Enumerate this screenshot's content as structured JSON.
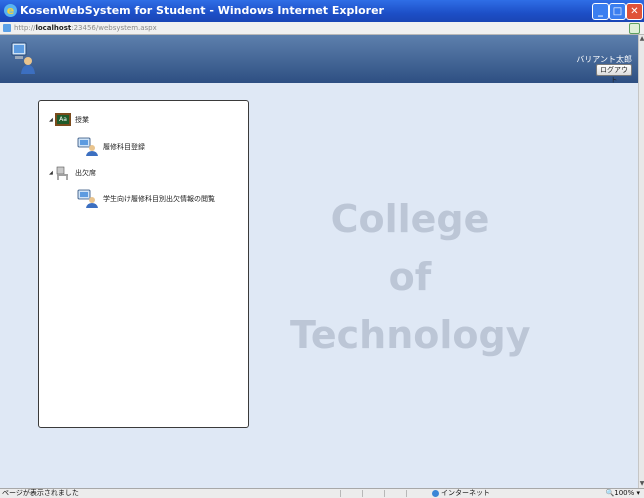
{
  "window": {
    "title": "KosenWebSystem for Student - Windows Internet Explorer"
  },
  "address": {
    "prefix": "http://",
    "host": "localhost",
    "rest": ":23456/websystem.aspx"
  },
  "header": {
    "user_name": "バリアント太郎",
    "logout_label": "ログアウト"
  },
  "tree": {
    "nodes": [
      {
        "label": "授業",
        "icon": "blackboard-icon"
      },
      {
        "label": "履修科目登録",
        "icon": "computer-user-icon"
      },
      {
        "label": "出欠席",
        "icon": "chair-icon"
      },
      {
        "label": "学生向け履修科目別出欠情報の閲覧",
        "icon": "computer-user-icon"
      }
    ]
  },
  "watermark": {
    "line1": "College",
    "line2": "of",
    "line3": "Technology"
  },
  "status": {
    "text": "ページが表示されました",
    "zone": "インターネット",
    "zoom": "100%"
  }
}
